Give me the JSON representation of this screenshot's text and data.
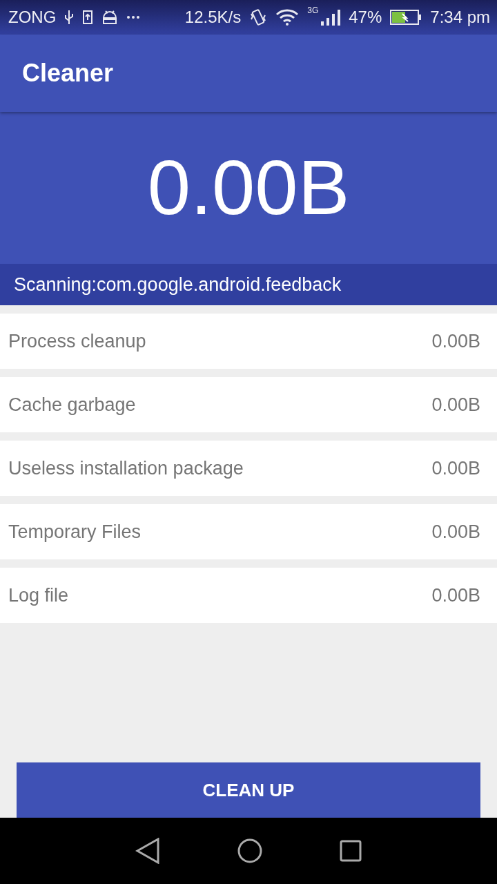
{
  "status_bar": {
    "carrier": "ZONG",
    "speed": "12.5K/s",
    "network": "3G",
    "battery": "47%",
    "time": "7:34 pm"
  },
  "app_bar": {
    "title": "Cleaner"
  },
  "summary": {
    "total": "0.00B",
    "scanning": "Scanning:com.google.android.feedback"
  },
  "items": [
    {
      "label": "Process cleanup",
      "size": "0.00B"
    },
    {
      "label": "Cache garbage",
      "size": "0.00B"
    },
    {
      "label": "Useless installation package",
      "size": "0.00B"
    },
    {
      "label": "Temporary Files",
      "size": "0.00B"
    },
    {
      "label": "Log file",
      "size": "0.00B"
    }
  ],
  "action_button": "CLEAN UP"
}
